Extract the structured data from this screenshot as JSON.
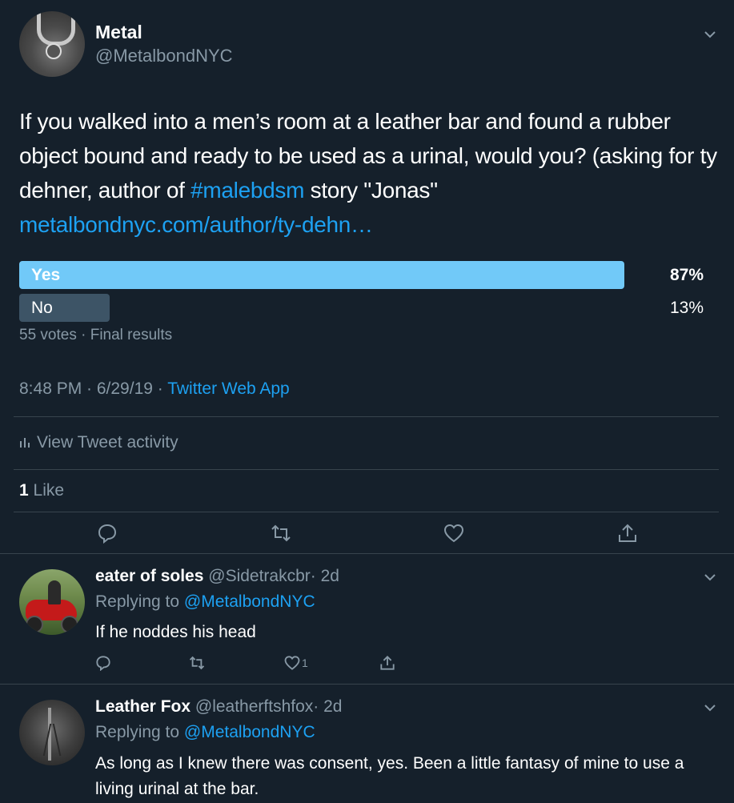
{
  "tweet": {
    "author_name": "Metal",
    "author_handle": "@MetalbondNYC",
    "text_prefix": "If you walked into a men’s room at a leather bar and found a rubber object bound and ready to be used as a urinal, would you? (asking for ty dehner, author of ",
    "hashtag": "#malebdsm",
    "text_middle": " story \"Jonas\" ",
    "link": "metalbondnyc.com/author/ty-dehn…",
    "poll": {
      "options": [
        {
          "label": "Yes",
          "percent": "87%",
          "share": 87
        },
        {
          "label": "No",
          "percent": "13%",
          "share": 13
        }
      ],
      "summary": "55 votes · Final results"
    },
    "time": "8:48 PM · 6/29/19 · ",
    "source": "Twitter Web App",
    "activity_label": "View Tweet activity",
    "likes_count": "1",
    "likes_label": " Like"
  },
  "replies": [
    {
      "name": "eater of soles",
      "handle": "@Sidetrakcbr",
      "age": "· 2d",
      "replying_prefix": "Replying to ",
      "replying_to": "@MetalbondNYC",
      "text": "If he noddes his head",
      "like_count": "1"
    },
    {
      "name": "Leather Fox",
      "handle": "@leatherftshfox",
      "age": "· 2d",
      "replying_prefix": "Replying to ",
      "replying_to": "@MetalbondNYC",
      "text": "As long as I knew there was consent, yes. Been a little fantasy of mine to use a living urinal at the bar."
    }
  ],
  "colors": {
    "background": "#15202b",
    "accent": "#1da1f2",
    "muted": "#8899a6",
    "poll_leader": "#71c9f8",
    "poll_other": "#3d5466"
  },
  "icons": [
    "chevron-down-icon",
    "reply-icon",
    "retweet-icon",
    "like-icon",
    "share-icon",
    "bar-chart-icon"
  ]
}
